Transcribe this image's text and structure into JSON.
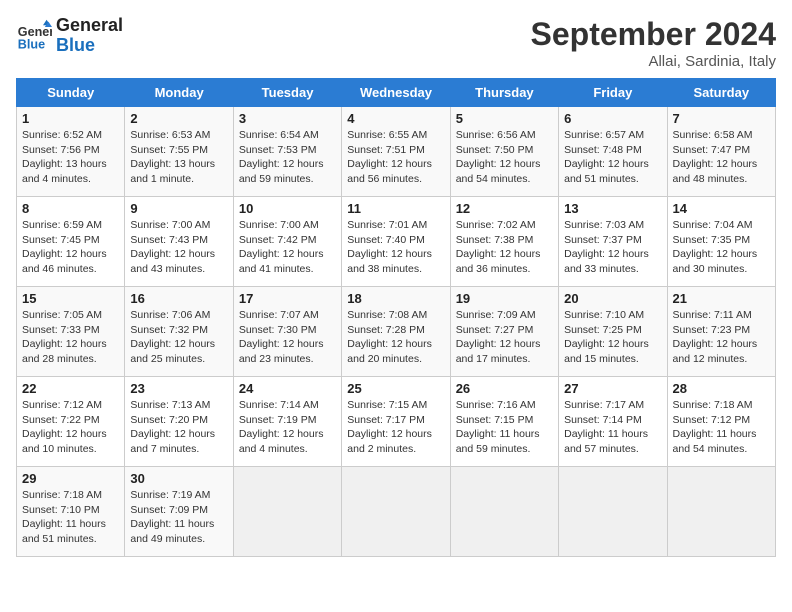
{
  "header": {
    "logo_line1": "General",
    "logo_line2": "Blue",
    "month_title": "September 2024",
    "subtitle": "Allai, Sardinia, Italy"
  },
  "weekdays": [
    "Sunday",
    "Monday",
    "Tuesday",
    "Wednesday",
    "Thursday",
    "Friday",
    "Saturday"
  ],
  "weeks": [
    [
      {
        "day": "1",
        "sunrise": "Sunrise: 6:52 AM",
        "sunset": "Sunset: 7:56 PM",
        "daylight": "Daylight: 13 hours and 4 minutes."
      },
      {
        "day": "2",
        "sunrise": "Sunrise: 6:53 AM",
        "sunset": "Sunset: 7:55 PM",
        "daylight": "Daylight: 13 hours and 1 minute."
      },
      {
        "day": "3",
        "sunrise": "Sunrise: 6:54 AM",
        "sunset": "Sunset: 7:53 PM",
        "daylight": "Daylight: 12 hours and 59 minutes."
      },
      {
        "day": "4",
        "sunrise": "Sunrise: 6:55 AM",
        "sunset": "Sunset: 7:51 PM",
        "daylight": "Daylight: 12 hours and 56 minutes."
      },
      {
        "day": "5",
        "sunrise": "Sunrise: 6:56 AM",
        "sunset": "Sunset: 7:50 PM",
        "daylight": "Daylight: 12 hours and 54 minutes."
      },
      {
        "day": "6",
        "sunrise": "Sunrise: 6:57 AM",
        "sunset": "Sunset: 7:48 PM",
        "daylight": "Daylight: 12 hours and 51 minutes."
      },
      {
        "day": "7",
        "sunrise": "Sunrise: 6:58 AM",
        "sunset": "Sunset: 7:47 PM",
        "daylight": "Daylight: 12 hours and 48 minutes."
      }
    ],
    [
      {
        "day": "8",
        "sunrise": "Sunrise: 6:59 AM",
        "sunset": "Sunset: 7:45 PM",
        "daylight": "Daylight: 12 hours and 46 minutes."
      },
      {
        "day": "9",
        "sunrise": "Sunrise: 7:00 AM",
        "sunset": "Sunset: 7:43 PM",
        "daylight": "Daylight: 12 hours and 43 minutes."
      },
      {
        "day": "10",
        "sunrise": "Sunrise: 7:00 AM",
        "sunset": "Sunset: 7:42 PM",
        "daylight": "Daylight: 12 hours and 41 minutes."
      },
      {
        "day": "11",
        "sunrise": "Sunrise: 7:01 AM",
        "sunset": "Sunset: 7:40 PM",
        "daylight": "Daylight: 12 hours and 38 minutes."
      },
      {
        "day": "12",
        "sunrise": "Sunrise: 7:02 AM",
        "sunset": "Sunset: 7:38 PM",
        "daylight": "Daylight: 12 hours and 36 minutes."
      },
      {
        "day": "13",
        "sunrise": "Sunrise: 7:03 AM",
        "sunset": "Sunset: 7:37 PM",
        "daylight": "Daylight: 12 hours and 33 minutes."
      },
      {
        "day": "14",
        "sunrise": "Sunrise: 7:04 AM",
        "sunset": "Sunset: 7:35 PM",
        "daylight": "Daylight: 12 hours and 30 minutes."
      }
    ],
    [
      {
        "day": "15",
        "sunrise": "Sunrise: 7:05 AM",
        "sunset": "Sunset: 7:33 PM",
        "daylight": "Daylight: 12 hours and 28 minutes."
      },
      {
        "day": "16",
        "sunrise": "Sunrise: 7:06 AM",
        "sunset": "Sunset: 7:32 PM",
        "daylight": "Daylight: 12 hours and 25 minutes."
      },
      {
        "day": "17",
        "sunrise": "Sunrise: 7:07 AM",
        "sunset": "Sunset: 7:30 PM",
        "daylight": "Daylight: 12 hours and 23 minutes."
      },
      {
        "day": "18",
        "sunrise": "Sunrise: 7:08 AM",
        "sunset": "Sunset: 7:28 PM",
        "daylight": "Daylight: 12 hours and 20 minutes."
      },
      {
        "day": "19",
        "sunrise": "Sunrise: 7:09 AM",
        "sunset": "Sunset: 7:27 PM",
        "daylight": "Daylight: 12 hours and 17 minutes."
      },
      {
        "day": "20",
        "sunrise": "Sunrise: 7:10 AM",
        "sunset": "Sunset: 7:25 PM",
        "daylight": "Daylight: 12 hours and 15 minutes."
      },
      {
        "day": "21",
        "sunrise": "Sunrise: 7:11 AM",
        "sunset": "Sunset: 7:23 PM",
        "daylight": "Daylight: 12 hours and 12 minutes."
      }
    ],
    [
      {
        "day": "22",
        "sunrise": "Sunrise: 7:12 AM",
        "sunset": "Sunset: 7:22 PM",
        "daylight": "Daylight: 12 hours and 10 minutes."
      },
      {
        "day": "23",
        "sunrise": "Sunrise: 7:13 AM",
        "sunset": "Sunset: 7:20 PM",
        "daylight": "Daylight: 12 hours and 7 minutes."
      },
      {
        "day": "24",
        "sunrise": "Sunrise: 7:14 AM",
        "sunset": "Sunset: 7:19 PM",
        "daylight": "Daylight: 12 hours and 4 minutes."
      },
      {
        "day": "25",
        "sunrise": "Sunrise: 7:15 AM",
        "sunset": "Sunset: 7:17 PM",
        "daylight": "Daylight: 12 hours and 2 minutes."
      },
      {
        "day": "26",
        "sunrise": "Sunrise: 7:16 AM",
        "sunset": "Sunset: 7:15 PM",
        "daylight": "Daylight: 11 hours and 59 minutes."
      },
      {
        "day": "27",
        "sunrise": "Sunrise: 7:17 AM",
        "sunset": "Sunset: 7:14 PM",
        "daylight": "Daylight: 11 hours and 57 minutes."
      },
      {
        "day": "28",
        "sunrise": "Sunrise: 7:18 AM",
        "sunset": "Sunset: 7:12 PM",
        "daylight": "Daylight: 11 hours and 54 minutes."
      }
    ],
    [
      {
        "day": "29",
        "sunrise": "Sunrise: 7:18 AM",
        "sunset": "Sunset: 7:10 PM",
        "daylight": "Daylight: 11 hours and 51 minutes."
      },
      {
        "day": "30",
        "sunrise": "Sunrise: 7:19 AM",
        "sunset": "Sunset: 7:09 PM",
        "daylight": "Daylight: 11 hours and 49 minutes."
      },
      null,
      null,
      null,
      null,
      null
    ]
  ]
}
